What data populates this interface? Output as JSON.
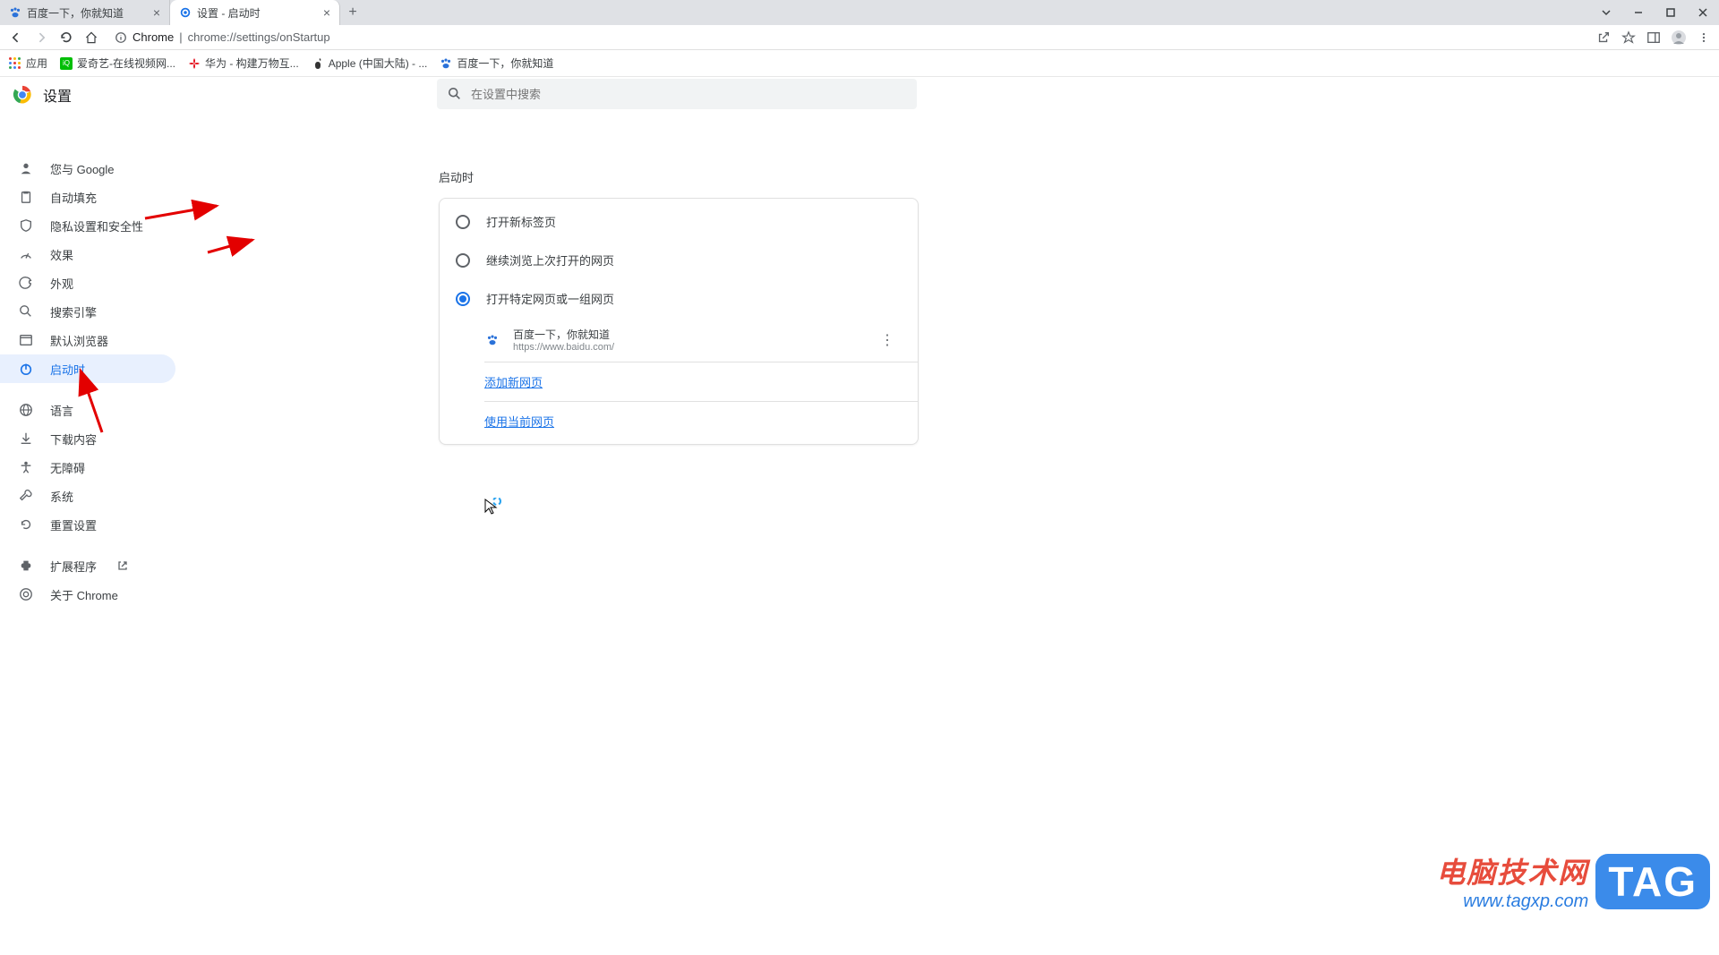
{
  "tabs": [
    {
      "title": "百度一下，你就知道",
      "icon": "baidu"
    },
    {
      "title": "设置 - 启动时",
      "icon": "gear"
    }
  ],
  "window_controls": {
    "dropdown": "⌄",
    "minimize": "—",
    "maximize": "▢",
    "close": "✕"
  },
  "toolbar": {
    "url_scheme_label": "Chrome",
    "url_display": "chrome://settings/onStartup"
  },
  "bookmarks": {
    "apps": "应用",
    "items": [
      {
        "label": "爱奇艺-在线视频网...",
        "icon": "iqiyi"
      },
      {
        "label": "华为 - 构建万物互...",
        "icon": "huawei"
      },
      {
        "label": "Apple (中国大陆) - ...",
        "icon": "apple"
      },
      {
        "label": "百度一下，你就知道",
        "icon": "baidu"
      }
    ]
  },
  "settings_title": "设置",
  "search_placeholder": "在设置中搜索",
  "sidebar": {
    "items": [
      {
        "label": "您与 Google",
        "icon": "person"
      },
      {
        "label": "自动填充",
        "icon": "clipboard"
      },
      {
        "label": "隐私设置和安全性",
        "icon": "shield"
      },
      {
        "label": "效果",
        "icon": "speed"
      },
      {
        "label": "外观",
        "icon": "palette"
      },
      {
        "label": "搜索引擎",
        "icon": "search"
      },
      {
        "label": "默认浏览器",
        "icon": "browser"
      },
      {
        "label": "启动时",
        "icon": "power",
        "active": true
      },
      {
        "label": "语言",
        "icon": "globe"
      },
      {
        "label": "下载内容",
        "icon": "download"
      },
      {
        "label": "无障碍",
        "icon": "accessibility"
      },
      {
        "label": "系统",
        "icon": "wrench"
      },
      {
        "label": "重置设置",
        "icon": "history"
      },
      {
        "label": "扩展程序",
        "icon": "puzzle",
        "launch": true
      },
      {
        "label": "关于 Chrome",
        "icon": "chrome"
      }
    ]
  },
  "main": {
    "section_title": "启动时",
    "radios": [
      {
        "label": "打开新标签页",
        "checked": false
      },
      {
        "label": "继续浏览上次打开的网页",
        "checked": false
      },
      {
        "label": "打开特定网页或一组网页",
        "checked": true
      }
    ],
    "startup_page": {
      "title": "百度一下，你就知道",
      "url": "https://www.baidu.com/"
    },
    "add_page_link": "添加新网页",
    "use_current_link": "使用当前网页"
  },
  "watermark": {
    "line1": "电脑技术网",
    "line2": "www.tagxp.com",
    "tag": "TAG"
  }
}
